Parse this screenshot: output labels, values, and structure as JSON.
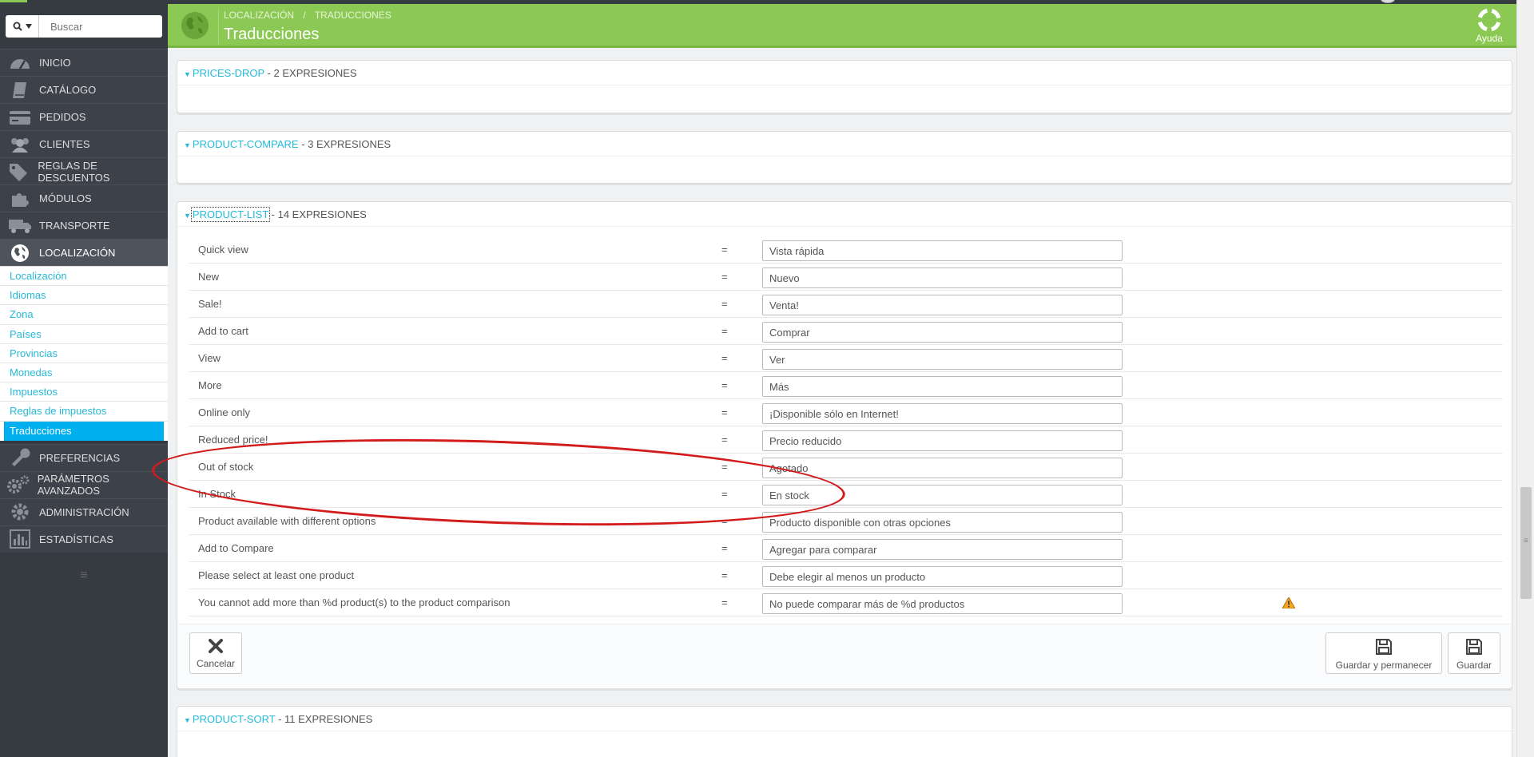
{
  "search": {
    "placeholder": "Buscar"
  },
  "sidebar": {
    "menu_top": [
      {
        "icon": "dashboard-icon",
        "label": "INICIO"
      },
      {
        "icon": "book-icon",
        "label": "CATÁLOGO"
      },
      {
        "icon": "credit-card-icon",
        "label": "PEDIDOS"
      },
      {
        "icon": "users-icon",
        "label": "CLIENTES"
      },
      {
        "icon": "tags-icon",
        "label": "REGLAS DE DESCUENTOS"
      },
      {
        "icon": "puzzle-icon",
        "label": "MÓDULOS"
      },
      {
        "icon": "truck-icon",
        "label": "TRANSPORTE"
      },
      {
        "icon": "globe-icon",
        "label": "LOCALIZACIÓN"
      }
    ],
    "submenu": [
      "Localización",
      "Idiomas",
      "Zona",
      "Países",
      "Provincias",
      "Monedas",
      "Impuestos",
      "Reglas de impuestos",
      "Traducciones"
    ],
    "menu_bottom": [
      {
        "icon": "wrench-icon",
        "label": "PREFERENCIAS"
      },
      {
        "icon": "cogs-icon",
        "label": "PARÁMETROS AVANZADOS"
      },
      {
        "icon": "cog-icon",
        "label": "ADMINISTRACIÓN"
      },
      {
        "icon": "bar-chart-icon",
        "label": "ESTADÍSTICAS"
      }
    ],
    "collapse_glyph": "≡"
  },
  "header": {
    "breadcrumb": [
      "LOCALIZACIÓN",
      "/",
      "TRADUCCIONES"
    ],
    "title": "Traducciones",
    "help_label": "Ayuda",
    "color": "#8bc954"
  },
  "panels": {
    "prices_drop": {
      "name": "PRICES-DROP",
      "count": " - 2 EXPRESIONES"
    },
    "product_compare": {
      "name": "PRODUCT-COMPARE",
      "count": " - 3 EXPRESIONES"
    },
    "product_list": {
      "name": "PRODUCT-LIST",
      "count": " - 14 EXPRESIONES"
    },
    "product_sort": {
      "name": "PRODUCT-SORT",
      "count": " - 11 EXPRESIONES"
    }
  },
  "product_list_rows": [
    {
      "src": "Quick view",
      "eq": "=",
      "value": "Vista rápida"
    },
    {
      "src": "New",
      "eq": "=",
      "value": "Nuevo"
    },
    {
      "src": "Sale!",
      "eq": "=",
      "value": "Venta!"
    },
    {
      "src": "Add to cart",
      "eq": "=",
      "value": "Comprar"
    },
    {
      "src": "View",
      "eq": "=",
      "value": "Ver"
    },
    {
      "src": "More",
      "eq": "=",
      "value": "Más"
    },
    {
      "src": "Online only",
      "eq": "=",
      "value": "¡Disponible sólo en Internet!"
    },
    {
      "src": "Reduced price!",
      "eq": "=",
      "value": "Precio reducido"
    },
    {
      "src": "Out of stock",
      "eq": "=",
      "value": "Agotado"
    },
    {
      "src": "In Stock",
      "eq": "=",
      "value": "En stock"
    },
    {
      "src": "Product available with different options",
      "eq": "=",
      "value": "Producto disponible con otras opciones"
    },
    {
      "src": "Add to Compare",
      "eq": "=",
      "value": "Agregar para comparar"
    },
    {
      "src": "Please select at least one product",
      "eq": "=",
      "value": "Debe elegir al menos un producto"
    },
    {
      "src": "You cannot add more than %d product(s) to the product comparison",
      "eq": "=",
      "value": "No puede comparar más de %d productos",
      "warning": true
    }
  ],
  "footer": {
    "cancel": "Cancelar",
    "save_stay": "Guardar y permanecer",
    "save": "Guardar"
  },
  "colors": {
    "accent": "#25b9d7",
    "active_item": "#00aff0",
    "annotation": "#d21c1c",
    "sidebar": "#363a41"
  }
}
